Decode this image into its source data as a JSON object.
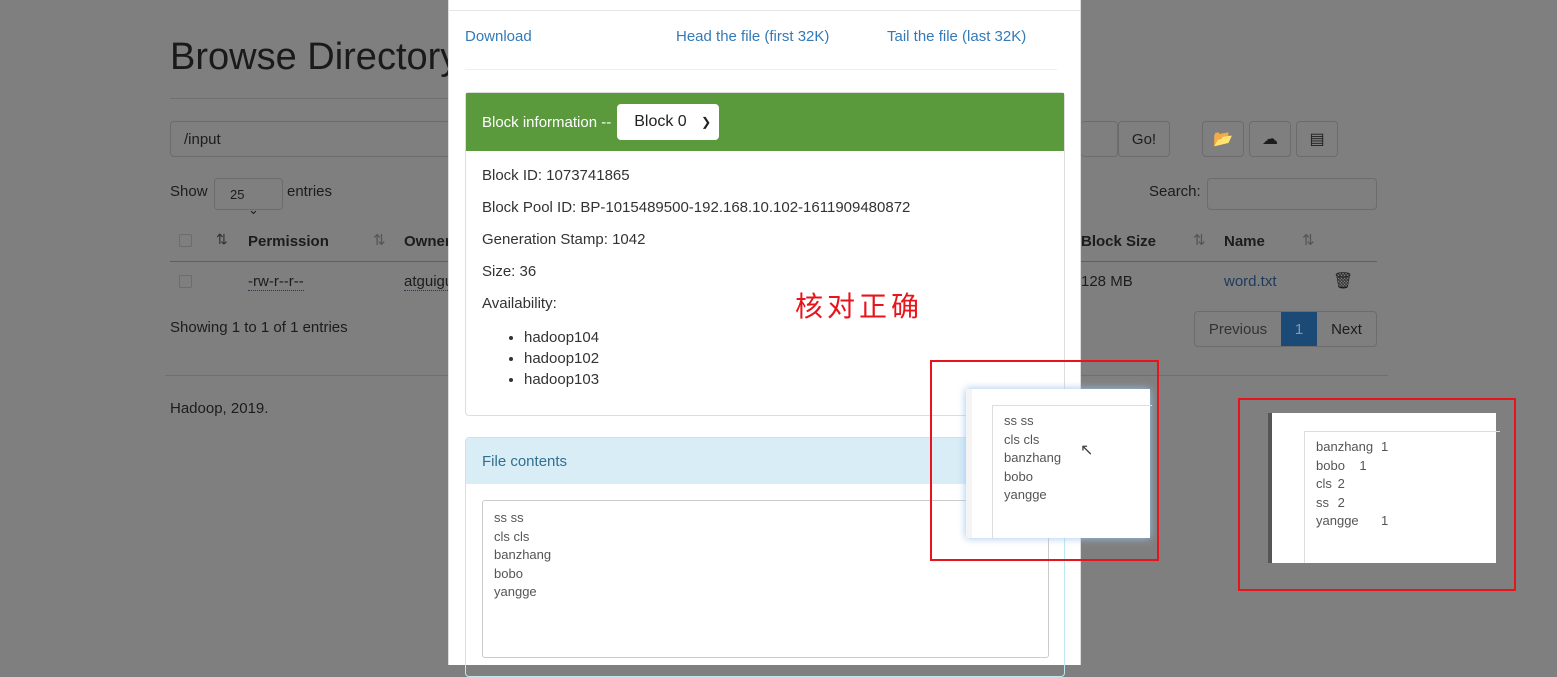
{
  "page": {
    "title": "Browse Directory",
    "path": "/input",
    "go_label": "Go!",
    "show_label": "Show",
    "entries_label": "entries",
    "page_size": "25",
    "search_label": "Search:",
    "search_value": "",
    "columns": [
      "Permission",
      "Owner",
      "Block Size",
      "Name"
    ],
    "row": {
      "permission": "-rw-r--r--",
      "owner": "atguigu",
      "block_size": "128 MB",
      "name": "word.txt"
    },
    "showing": "Showing 1 to 1 of 1 entries",
    "pagination": {
      "previous": "Previous",
      "current": "1",
      "next": "Next"
    },
    "footer": "Hadoop, 2019.",
    "icons": [
      "folder-open-icon",
      "cloud-upload-icon",
      "list-icon",
      "trash-icon",
      "sort-icon"
    ]
  },
  "modal": {
    "download": "Download",
    "head": "Head the file (first 32K)",
    "tail": "Tail the file (last 32K)",
    "block_header": "Block information --",
    "block_select": "Block 0",
    "block_id": "Block ID: 1073741865",
    "block_pool_id": "Block Pool ID: BP-1015489500-192.168.10.102-1611909480872",
    "generation_stamp": "Generation Stamp: 1042",
    "size": "Size: 36",
    "availability": "Availability:",
    "nodes": [
      "hadoop104",
      "hadoop102",
      "hadoop103"
    ],
    "file_contents_label": "File contents",
    "file_contents": "ss ss\ncls cls\nbanzhang\nbobo\nyangge",
    "colors": {
      "block_header": "#5a9a3c",
      "link": "#337ab7",
      "file_header": "#d9edf7"
    }
  },
  "annotation": {
    "text": "核对正确",
    "color": "#e8141c"
  },
  "snippet_input": "ss ss\ncls cls\nbanzhang\nbobo\nyangge",
  "snippet_output": "banzhang\t1\nbobo\t1\ncls\t2\nss\t2\nyangge\t1"
}
